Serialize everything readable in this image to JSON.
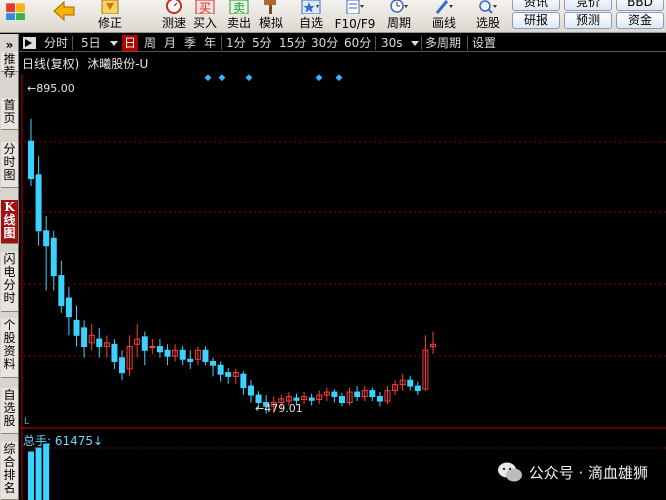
{
  "toolbar": {
    "buttons": [
      {
        "label": "",
        "icon": "grid-icon"
      },
      {
        "label": "",
        "icon": "back-arrow-icon"
      },
      {
        "label": "修正",
        "icon": "down-arrow-icon"
      },
      {
        "label": "测速",
        "icon": "stopwatch-icon"
      },
      {
        "label": "买入",
        "icon": "buy-icon"
      },
      {
        "label": "卖出",
        "icon": "sell-icon"
      },
      {
        "label": "模拟",
        "icon": "hammer-icon"
      },
      {
        "label": "自选",
        "icon": "star-icon"
      },
      {
        "label": "F10/F9",
        "icon": "document-icon"
      },
      {
        "label": "周期",
        "icon": "clock-icon"
      },
      {
        "label": "画线",
        "icon": "pen-icon"
      },
      {
        "label": "选股",
        "icon": "magnifier-icon"
      }
    ],
    "right_top": [
      "资讯",
      "竞价",
      "BBD"
    ],
    "right_bottom": [
      "研报",
      "预测",
      "资金"
    ]
  },
  "sidetabs": [
    {
      "label": "推荐"
    },
    {
      "label": "首页"
    },
    {
      "label": "分时图"
    },
    {
      "label": "K线图",
      "active": true
    },
    {
      "label": "闪电分时"
    },
    {
      "label": "个股资料"
    },
    {
      "label": "自选股"
    },
    {
      "label": "综合排名"
    }
  ],
  "periodbar": {
    "items": [
      "分时",
      "5日",
      "日",
      "周",
      "月",
      "季",
      "年",
      "1分",
      "5分",
      "15分",
      "30分",
      "60分",
      "30s",
      "多周期",
      "设置"
    ],
    "selected": "日"
  },
  "chart_header": {
    "mode": "日线(复权)",
    "stock": "沐曦股份-U"
  },
  "chart_data": {
    "type": "candlestick",
    "max_label": "895.00",
    "min_label": "479.01",
    "ylim": [
      460,
      910
    ],
    "candles": [
      [
        820,
        770,
        850,
        760
      ],
      [
        775,
        700,
        800,
        680
      ],
      [
        700,
        680,
        720,
        620
      ],
      [
        690,
        640,
        700,
        620
      ],
      [
        640,
        600,
        660,
        590
      ],
      [
        610,
        585,
        625,
        560
      ],
      [
        580,
        560,
        600,
        545
      ],
      [
        570,
        545,
        580,
        530
      ],
      [
        550,
        560,
        575,
        540
      ],
      [
        555,
        545,
        570,
        530
      ],
      [
        545,
        550,
        560,
        530
      ],
      [
        548,
        525,
        555,
        515
      ],
      [
        530,
        510,
        540,
        500
      ],
      [
        515,
        545,
        560,
        505
      ],
      [
        548,
        555,
        575,
        530
      ],
      [
        558,
        540,
        565,
        520
      ],
      [
        545,
        545,
        555,
        535
      ],
      [
        545,
        538,
        555,
        530
      ],
      [
        540,
        532,
        548,
        520
      ],
      [
        532,
        540,
        548,
        525
      ],
      [
        540,
        528,
        546,
        520
      ],
      [
        528,
        525,
        540,
        515
      ],
      [
        528,
        540,
        545,
        520
      ],
      [
        540,
        525,
        545,
        520
      ],
      [
        525,
        520,
        530,
        505
      ],
      [
        520,
        508,
        525,
        498
      ],
      [
        510,
        505,
        516,
        495
      ],
      [
        505,
        510,
        515,
        495
      ],
      [
        508,
        490,
        512,
        480
      ],
      [
        492,
        480,
        500,
        470
      ],
      [
        480,
        470,
        485,
        462
      ],
      [
        470,
        465,
        480,
        455
      ],
      [
        465,
        470,
        478,
        456
      ],
      [
        470,
        475,
        480,
        462
      ],
      [
        472,
        478,
        484,
        466
      ],
      [
        476,
        473,
        482,
        466
      ],
      [
        474,
        478,
        484,
        468
      ],
      [
        476,
        473,
        482,
        466
      ],
      [
        474,
        480,
        486,
        468
      ],
      [
        480,
        484,
        490,
        472
      ],
      [
        484,
        478,
        488,
        470
      ],
      [
        478,
        470,
        483,
        465
      ],
      [
        470,
        484,
        490,
        466
      ],
      [
        484,
        478,
        492,
        472
      ],
      [
        478,
        486,
        492,
        472
      ],
      [
        486,
        478,
        490,
        472
      ],
      [
        478,
        472,
        484,
        465
      ],
      [
        472,
        486,
        492,
        468
      ],
      [
        486,
        494,
        500,
        480
      ],
      [
        494,
        500,
        508,
        486
      ],
      [
        500,
        492,
        506,
        486
      ],
      [
        492,
        486,
        498,
        480
      ],
      [
        488,
        540,
        560,
        486
      ],
      [
        545,
        548,
        565,
        535
      ]
    ],
    "markers": [
      "◆",
      "◆",
      "◆",
      "◆",
      "◆"
    ],
    "volume_label": "总手: 61475↓"
  },
  "watermark": {
    "text": "公众号 · 滴血雄狮"
  },
  "colors": {
    "up": "#ff3c3c",
    "down": "#3cd2ff",
    "grid": "#8b0000",
    "selected": "#b00000"
  }
}
